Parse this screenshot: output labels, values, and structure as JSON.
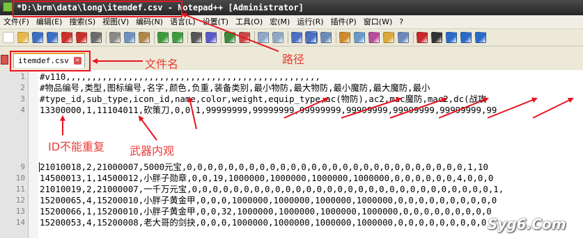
{
  "window": {
    "title": "*D:\\brm\\data\\long\\itemdef.csv - Notepad++ [Administrator]"
  },
  "menubar": {
    "items": [
      {
        "label": "文件(F)"
      },
      {
        "label": "编辑(E)"
      },
      {
        "label": "搜索(S)"
      },
      {
        "label": "视图(V)"
      },
      {
        "label": "编码(N)"
      },
      {
        "label": "语言(L)"
      },
      {
        "label": "设置(T)"
      },
      {
        "label": "工具(O)"
      },
      {
        "label": "宏(M)"
      },
      {
        "label": "运行(R)"
      },
      {
        "label": "插件(P)"
      },
      {
        "label": "窗口(W)"
      },
      {
        "label": "?"
      }
    ]
  },
  "toolbar": {
    "icons": [
      "new-file-icon",
      "open-file-icon",
      "save-icon",
      "save-all-icon",
      "close-icon",
      "close-all-icon",
      "print-icon",
      "cut-icon",
      "copy-icon",
      "paste-icon",
      "undo-icon",
      "redo-icon",
      "find-icon",
      "replace-icon",
      "zoom-in-icon",
      "zoom-out-icon",
      "sync-vertical-icon",
      "sync-horizontal-icon",
      "word-wrap-icon",
      "show-all-chars-icon",
      "indent-guide-icon",
      "udl-icon",
      "doc-map-icon",
      "function-list-icon",
      "folder-workspace-icon",
      "monitor-icon",
      "record-macro-icon",
      "stop-record-icon",
      "play-macro-icon",
      "play-multiple-icon",
      "save-macro-icon"
    ],
    "colors": [
      "#ffffff",
      "#e8b84a",
      "#3a6fc4",
      "#3a6fc4",
      "#c9302c",
      "#c9302c",
      "#6b6b6b",
      "#8a8a8a",
      "#6f8fbf",
      "#b0874a",
      "#3c9a3c",
      "#3c9a3c",
      "#555555",
      "#5a5ac8",
      "#3a8a3a",
      "#c84848",
      "#8fa8c8",
      "#8fa8c8",
      "#4a6fc4",
      "#4a6fc4",
      "#6a8ab8",
      "#d08a2a",
      "#6a9ac8",
      "#b84a9a",
      "#d8a838",
      "#6a8ab8",
      "#c82828",
      "#333333",
      "#2a6ac8",
      "#2a6ac8",
      "#2a6ac8"
    ]
  },
  "tabs": [
    {
      "label": "itemdef.csv"
    }
  ],
  "editor": {
    "lines": [
      {
        "num": "1",
        "text": "#v110,,,,,,,,,,,,,,,,,,,,,,,,,,,,,,,,,,,,,,,,,,,,,,,,,"
      },
      {
        "num": "2",
        "text": "#物品编号,类型,图标编号,名字,颜色,负重,装备类别,最小物防,最大物防,最小魔防,最大魔防,最小"
      },
      {
        "num": "3",
        "text": "#type_id,sub_type,icon_id,name,color,weight,equip_type,ac(物防),ac2,mac魔防,mac2,dc(战攻"
      },
      {
        "num": "4",
        "text": "13300000,1,11104011,砍策刀,0,0,1,99999999,99999999,99999999,99999999,99999999,99999999,99"
      },
      {
        "num": "9",
        "text": "21010018,2,21000007,5000元宝,0,0,0,0,0,0,0,0,0,0,0,0,0,0,0,0,0,0,0,0,0,0,0,0,0,0,0,1,10"
      },
      {
        "num": "10",
        "text": "14500013,1,14500012,小胖子勋章,0,0,19,1000000,1000000,1000000,1000000,0,0,0,0,0,0,4,0,0,0"
      },
      {
        "num": "11",
        "text": "21010019,2,21000007,一千万元宝,0,0,0,0,0,0,0,0,0,0,0,0,0,0,0,0,0,0,0,0,0,0,0,0,0,0,0,0,0,1,"
      },
      {
        "num": "12",
        "text": "15200065,4,15200010,小胖子黄金甲,0,0,0,1000000,1000000,1000000,1000000,0,0,0,0,0,0,0,0,0,0"
      },
      {
        "num": "13",
        "text": "15200066,1,15200010,小胖子黄金甲,0,0,32,1000000,1000000,1000000,1000000,0,0,0,0,0,0,0,0,0"
      },
      {
        "num": "14",
        "text": "15200053,4,15200008,老大哥的剑抉,0,0,0,1000000,1000000,1000000,1000000,0,0,0,0,0,0,0,0,0"
      }
    ]
  },
  "annotations": {
    "filename": "文件名",
    "path": "路径",
    "id_note": "ID不能重复",
    "weapon_note": "武器内观"
  },
  "watermark": "Syg6.Com",
  "colors": {
    "annotation_red": "#e8141e",
    "tab_accent": "#f0a030"
  }
}
